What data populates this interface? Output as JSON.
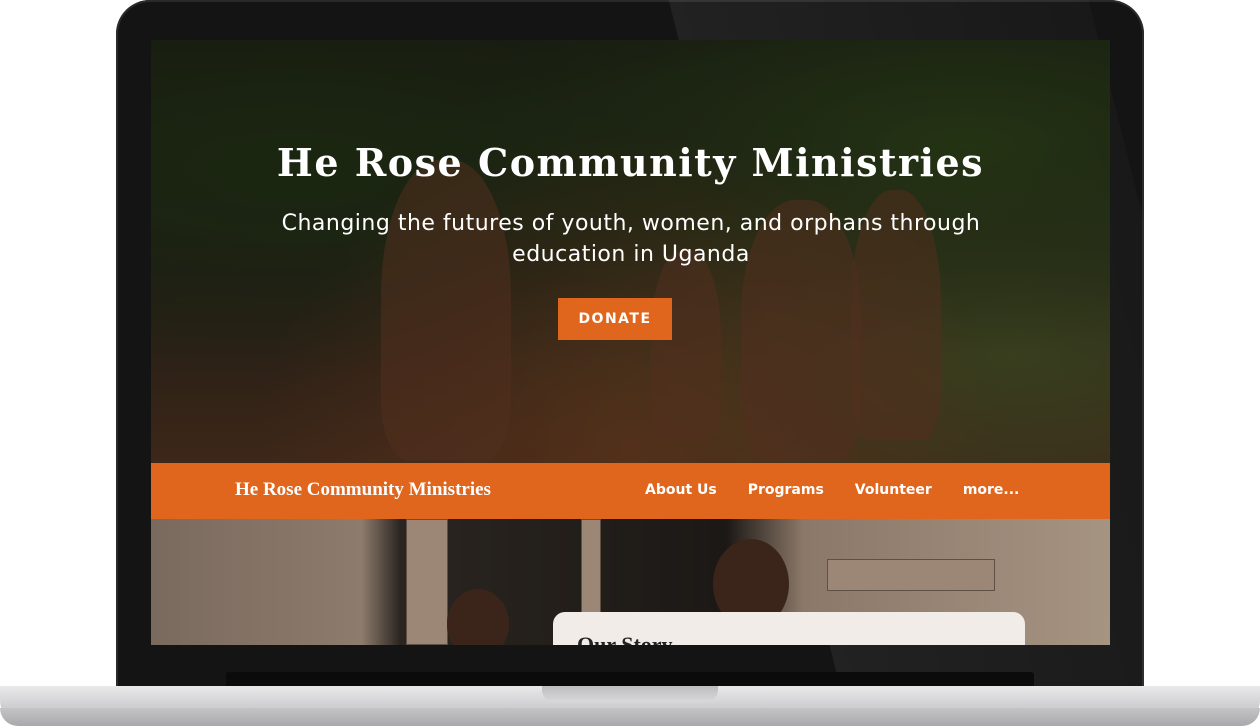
{
  "hero": {
    "title": "He Rose Community Ministries",
    "subtitle": "Changing the futures of youth, women, and orphans through education in Uganda",
    "donate_label": "DONATE"
  },
  "navbar": {
    "brand": "He Rose Community Ministries",
    "links": [
      {
        "label": "About Us"
      },
      {
        "label": "Programs"
      },
      {
        "label": "Volunteer"
      },
      {
        "label": "more..."
      }
    ]
  },
  "story": {
    "title": "Our Story"
  },
  "colors": {
    "accent": "#e0661e",
    "frame": "#141414",
    "card_bg": "#f2ece8"
  }
}
